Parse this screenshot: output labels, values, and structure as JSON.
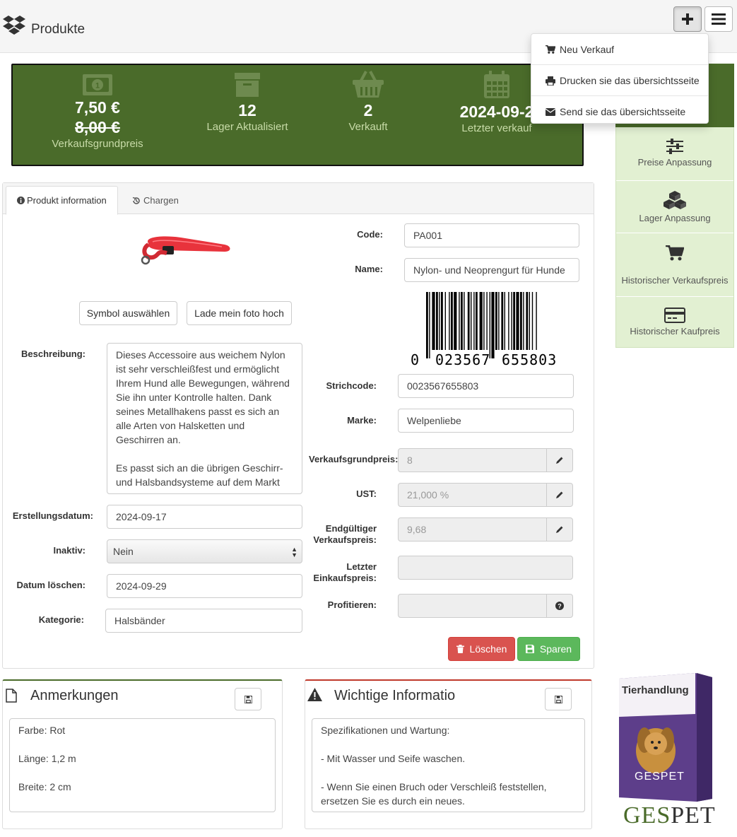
{
  "header": {
    "title": "Produkte",
    "add_button_icon": "plus-icon",
    "menu_button_icon": "hamburger-icon"
  },
  "dropdown": {
    "items": [
      {
        "label": "Neu Verkauf",
        "icon": "cart-icon"
      },
      {
        "label": "Drucken sie das übersichtsseite",
        "icon": "print-icon"
      },
      {
        "label": "Send sie das übersichtsseite",
        "icon": "envelope-icon"
      }
    ]
  },
  "stats": {
    "price": {
      "value": "7,50 €",
      "old_value": "8,00 €",
      "label": "Verkaufsgrundpreis",
      "icon": "money-icon"
    },
    "stock": {
      "value": "12",
      "label": "Lager Aktualisiert",
      "icon": "archive-icon"
    },
    "sold": {
      "value": "2",
      "label": "Verkauft",
      "icon": "basket-icon"
    },
    "last_sale": {
      "value": "2024-09-2",
      "label": "Letzter verkauf",
      "icon": "calendar-icon"
    }
  },
  "sidemenu": {
    "items": [
      {
        "label": "Preise Anpassung",
        "icon": "sliders-icon"
      },
      {
        "label": "Lager Anpassung",
        "icon": "cubes-icon"
      },
      {
        "label": "Historischer Verkaufspreis",
        "icon": "cart-icon"
      },
      {
        "label": "Historischer Kaufpreis",
        "icon": "credit-card-icon"
      }
    ]
  },
  "tabs": [
    {
      "label": "Produkt information",
      "icon": "info-icon",
      "active": true
    },
    {
      "label": "Chargen",
      "icon": "history-icon",
      "active": false
    }
  ],
  "form": {
    "symbol_button": "Symbol auswählen",
    "upload_button": "Lade mein foto hoch",
    "code_label": "Code:",
    "code_value": "PA001",
    "name_label": "Name:",
    "name_value": "Nylon- und Neoprengurt für Hunde",
    "barcode_digits": {
      "first": "0",
      "group1": "023567",
      "group2": "655803"
    },
    "description_label": "Beschreibung:",
    "description_value": "Dieses Accessoire aus weichem Nylon ist sehr verschleißfest und ermöglicht Ihrem Hund alle Bewegungen, während Sie ihn unter Kontrolle halten. Dank seines Metallhakens passt es sich an alle Arten von Halsketten und Geschirren an.\n\nEs passt sich an die übrigen Geschirr- und Halsbandsysteme auf dem Markt an",
    "created_label": "Erstellungsdatum:",
    "created_value": "2024-09-17",
    "inactive_label": "Inaktiv:",
    "inactive_value": "Nein",
    "delete_date_label": "Datum löschen:",
    "delete_date_value": "2024-09-29",
    "category_label": "Kategorie:",
    "category_value": "Halsbänder",
    "barcode_label": "Strichcode:",
    "barcode_value": "0023567655803",
    "brand_label": "Marke:",
    "brand_value": "Welpenliebe",
    "base_price_label": "Verkaufsgrundpreis:",
    "base_price_value": "8",
    "vat_label": "UST:",
    "vat_value": "21,000 %",
    "final_price_label_1": "Endgültiger",
    "final_price_label_2": "Verkaufspreis:",
    "final_price_value": "9,68",
    "last_purchase_label_1": "Letzter",
    "last_purchase_label_2": "Einkaufspreis:",
    "last_purchase_value": "",
    "profit_label": "Profitieren:",
    "profit_value": "",
    "delete_button": "Löschen",
    "save_button": "Sparen"
  },
  "notes": {
    "title": "Anmerkungen",
    "content": "Farbe: Rot\n\nLänge: 1,2 m\n\nBreite: 2 cm"
  },
  "important": {
    "title": "Wichtige Informatio",
    "content": "Spezifikationen und Wartung:\n\n- Mit Wasser und Seife waschen.\n\n- Wenn Sie einen Bruch oder Verschleiß feststellen, ersetzen Sie es durch ein neues."
  },
  "promo": {
    "box_title": "Tierhandlung",
    "box_brand": "GESPET",
    "logo_text_ges": "GES",
    "logo_text_pet": "PET"
  },
  "colors": {
    "brand_green": "#4a6b2a",
    "side_bg": "#e2f0d2",
    "danger": "#d9534f",
    "success": "#5cb85c"
  }
}
